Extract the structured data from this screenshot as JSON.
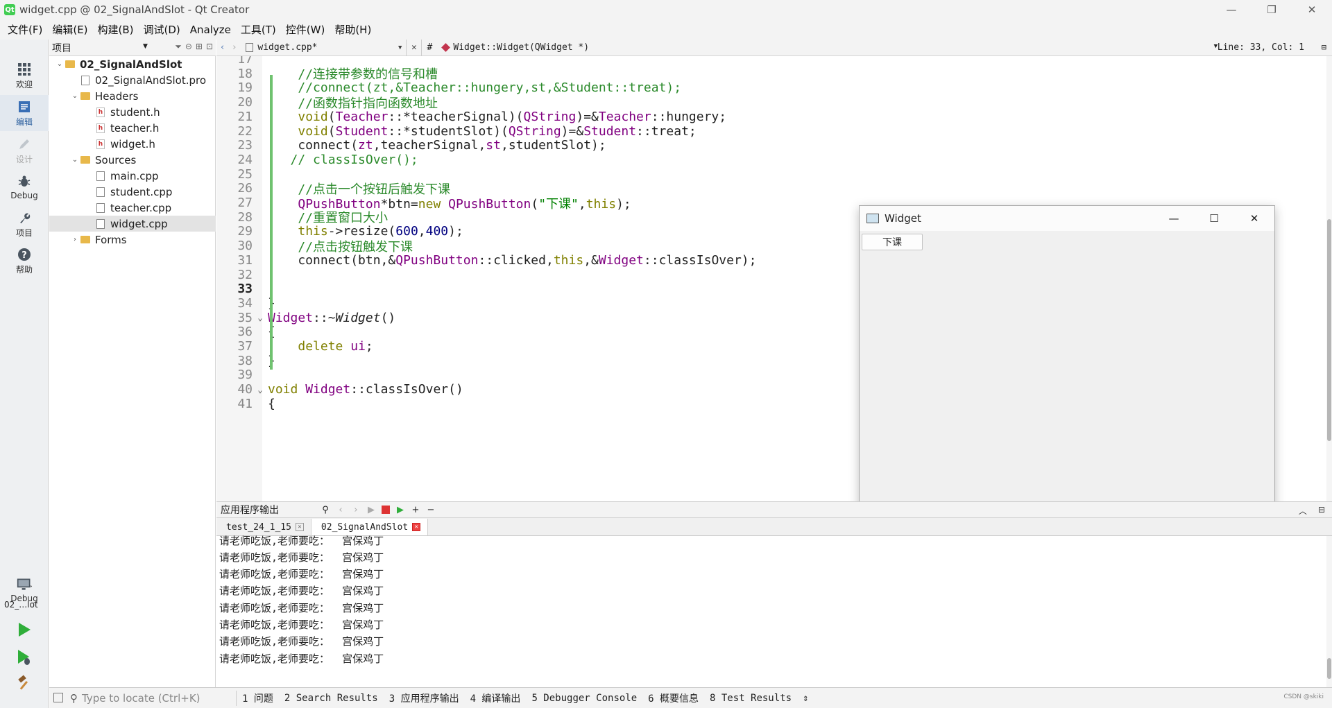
{
  "window": {
    "title": "widget.cpp @ 02_SignalAndSlot - Qt Creator",
    "app_icon": "Qt",
    "controls": [
      "—",
      "❐",
      "✕"
    ]
  },
  "menu": [
    "文件(F)",
    "编辑(E)",
    "构建(B)",
    "调试(D)",
    "Analyze",
    "工具(T)",
    "控件(W)",
    "帮助(H)"
  ],
  "modes": [
    {
      "label": "欢迎",
      "icon": "grid-icon"
    },
    {
      "label": "编辑",
      "icon": "edit-icon"
    },
    {
      "label": "设计",
      "icon": "pencil-icon"
    },
    {
      "label": "Debug",
      "icon": "bug-icon"
    },
    {
      "label": "项目",
      "icon": "wrench-icon"
    },
    {
      "label": "帮助",
      "icon": "help-icon"
    }
  ],
  "kit": {
    "name": "02_…lot",
    "config": "Debug"
  },
  "project_pane": {
    "title": "项目",
    "tree": [
      {
        "label": "02_SignalAndSlot",
        "arrow": "⌄",
        "type": "project"
      },
      {
        "label": "02_SignalAndSlot.pro",
        "arrow": "",
        "type": "pro"
      },
      {
        "label": "Headers",
        "arrow": "⌄",
        "type": "folder"
      },
      {
        "label": "student.h",
        "arrow": "",
        "type": "h"
      },
      {
        "label": "teacher.h",
        "arrow": "",
        "type": "h"
      },
      {
        "label": "widget.h",
        "arrow": "",
        "type": "h"
      },
      {
        "label": "Sources",
        "arrow": "⌄",
        "type": "folder"
      },
      {
        "label": "main.cpp",
        "arrow": "",
        "type": "cpp"
      },
      {
        "label": "student.cpp",
        "arrow": "",
        "type": "cpp"
      },
      {
        "label": "teacher.cpp",
        "arrow": "",
        "type": "cpp"
      },
      {
        "label": "widget.cpp",
        "arrow": "",
        "type": "cpp",
        "selected": true
      },
      {
        "label": "Forms",
        "arrow": "›",
        "type": "folder"
      }
    ]
  },
  "editor_toolbar": {
    "file": "widget.cpp*",
    "hash": "#",
    "symbol": "Widget::Widget(QWidget *)",
    "position": "Line: 33, Col: 1"
  },
  "code": [
    {
      "n": "17",
      "fold": "",
      "parts": [
        {
          "t": "",
          "c": ""
        }
      ]
    },
    {
      "n": "18",
      "fold": "",
      "parts": [
        {
          "t": "    ",
          "c": ""
        },
        {
          "t": "//连接带参数的信号和槽",
          "c": "c-com"
        }
      ]
    },
    {
      "n": "19",
      "fold": "",
      "parts": [
        {
          "t": "    ",
          "c": ""
        },
        {
          "t": "//connect(zt,&Teacher::hungery,st,&Student::treat);",
          "c": "c-com"
        }
      ]
    },
    {
      "n": "20",
      "fold": "",
      "parts": [
        {
          "t": "    ",
          "c": ""
        },
        {
          "t": "//函数指针指向函数地址",
          "c": "c-com"
        }
      ]
    },
    {
      "n": "21",
      "fold": "",
      "parts": [
        {
          "t": "    ",
          "c": ""
        },
        {
          "t": "void",
          "c": "c-kw"
        },
        {
          "t": "(",
          "c": ""
        },
        {
          "t": "Teacher",
          "c": "c-type"
        },
        {
          "t": "::*teacherSignal)(",
          "c": ""
        },
        {
          "t": "QString",
          "c": "c-type"
        },
        {
          "t": ")=&",
          "c": ""
        },
        {
          "t": "Teacher",
          "c": "c-type"
        },
        {
          "t": "::hungery;",
          "c": ""
        }
      ]
    },
    {
      "n": "22",
      "fold": "",
      "parts": [
        {
          "t": "    ",
          "c": ""
        },
        {
          "t": "void",
          "c": "c-kw"
        },
        {
          "t": "(",
          "c": ""
        },
        {
          "t": "Student",
          "c": "c-type"
        },
        {
          "t": "::*studentSlot)(",
          "c": ""
        },
        {
          "t": "QString",
          "c": "c-type"
        },
        {
          "t": ")=&",
          "c": ""
        },
        {
          "t": "Student",
          "c": "c-type"
        },
        {
          "t": "::treat;",
          "c": ""
        }
      ]
    },
    {
      "n": "23",
      "fold": "",
      "parts": [
        {
          "t": "    connect(",
          "c": ""
        },
        {
          "t": "zt",
          "c": "c-type"
        },
        {
          "t": ",teacherSignal,",
          "c": ""
        },
        {
          "t": "st",
          "c": "c-type"
        },
        {
          "t": ",studentSlot);",
          "c": ""
        }
      ]
    },
    {
      "n": "24",
      "fold": "",
      "parts": [
        {
          "t": "   ",
          "c": ""
        },
        {
          "t": "// classIsOver();",
          "c": "c-com"
        }
      ]
    },
    {
      "n": "25",
      "fold": "",
      "parts": [
        {
          "t": "",
          "c": ""
        }
      ]
    },
    {
      "n": "26",
      "fold": "",
      "parts": [
        {
          "t": "    ",
          "c": ""
        },
        {
          "t": "//点击一个按钮后触发下课",
          "c": "c-com"
        }
      ]
    },
    {
      "n": "27",
      "fold": "",
      "parts": [
        {
          "t": "    ",
          "c": ""
        },
        {
          "t": "QPushButton",
          "c": "c-type"
        },
        {
          "t": "*btn=",
          "c": ""
        },
        {
          "t": "new",
          "c": "c-kw"
        },
        {
          "t": " ",
          "c": ""
        },
        {
          "t": "QPushButton",
          "c": "c-type"
        },
        {
          "t": "(",
          "c": ""
        },
        {
          "t": "\"下课\"",
          "c": "c-str"
        },
        {
          "t": ",",
          "c": ""
        },
        {
          "t": "this",
          "c": "c-kw"
        },
        {
          "t": ");",
          "c": ""
        }
      ]
    },
    {
      "n": "28",
      "fold": "",
      "parts": [
        {
          "t": "    ",
          "c": ""
        },
        {
          "t": "//重置窗口大小",
          "c": "c-com"
        }
      ]
    },
    {
      "n": "29",
      "fold": "",
      "parts": [
        {
          "t": "    ",
          "c": ""
        },
        {
          "t": "this",
          "c": "c-kw"
        },
        {
          "t": "->resize(",
          "c": ""
        },
        {
          "t": "600",
          "c": "c-num"
        },
        {
          "t": ",",
          "c": ""
        },
        {
          "t": "400",
          "c": "c-num"
        },
        {
          "t": ");",
          "c": ""
        }
      ]
    },
    {
      "n": "30",
      "fold": "",
      "parts": [
        {
          "t": "    ",
          "c": ""
        },
        {
          "t": "//点击按钮触发下课",
          "c": "c-com"
        }
      ]
    },
    {
      "n": "31",
      "fold": "",
      "parts": [
        {
          "t": "    connect(btn,&",
          "c": ""
        },
        {
          "t": "QPushButton",
          "c": "c-type"
        },
        {
          "t": "::clicked,",
          "c": ""
        },
        {
          "t": "this",
          "c": "c-kw"
        },
        {
          "t": ",&",
          "c": ""
        },
        {
          "t": "Widget",
          "c": "c-type"
        },
        {
          "t": "::classIsOver);",
          "c": ""
        }
      ]
    },
    {
      "n": "32",
      "fold": "",
      "parts": [
        {
          "t": "",
          "c": ""
        }
      ]
    },
    {
      "n": "33",
      "fold": "",
      "current": true,
      "parts": [
        {
          "t": "",
          "c": ""
        }
      ]
    },
    {
      "n": "34",
      "fold": "",
      "parts": [
        {
          "t": "}",
          "c": ""
        }
      ]
    },
    {
      "n": "35",
      "fold": "⌄",
      "parts": [
        {
          "t": "Widget",
          "c": "c-type"
        },
        {
          "t": "::~",
          "c": ""
        },
        {
          "t": "Widget",
          "c": "c-it"
        },
        {
          "t": "()",
          "c": ""
        }
      ]
    },
    {
      "n": "36",
      "fold": "",
      "parts": [
        {
          "t": "{",
          "c": ""
        }
      ]
    },
    {
      "n": "37",
      "fold": "",
      "parts": [
        {
          "t": "    ",
          "c": ""
        },
        {
          "t": "delete",
          "c": "c-kw"
        },
        {
          "t": " ",
          "c": ""
        },
        {
          "t": "ui",
          "c": "c-type"
        },
        {
          "t": ";",
          "c": ""
        }
      ]
    },
    {
      "n": "38",
      "fold": "",
      "parts": [
        {
          "t": "}",
          "c": ""
        }
      ]
    },
    {
      "n": "39",
      "fold": "",
      "parts": [
        {
          "t": "",
          "c": ""
        }
      ]
    },
    {
      "n": "40",
      "fold": "⌄",
      "parts": [
        {
          "t": "void",
          "c": "c-kw"
        },
        {
          "t": " ",
          "c": ""
        },
        {
          "t": "Widget",
          "c": "c-type"
        },
        {
          "t": "::classIsOver()",
          "c": ""
        }
      ]
    },
    {
      "n": "41",
      "fold": "",
      "parts": [
        {
          "t": "{",
          "c": ""
        }
      ]
    }
  ],
  "widget_window": {
    "title": "Widget",
    "button_label": "下课",
    "controls": [
      "—",
      "☐",
      "✕"
    ]
  },
  "output": {
    "title": "应用程序输出",
    "tabs": [
      {
        "label": "test_24_1_15",
        "active": false
      },
      {
        "label": "02_SignalAndSlot",
        "active": true
      }
    ],
    "lines": [
      "请老师吃饭,老师要吃：  宫保鸡丁",
      "请老师吃饭,老师要吃：  宫保鸡丁",
      "请老师吃饭,老师要吃：  宫保鸡丁",
      "请老师吃饭,老师要吃：  宫保鸡丁",
      "请老师吃饭,老师要吃：  宫保鸡丁",
      "请老师吃饭,老师要吃：  宫保鸡丁",
      "请老师吃饭,老师要吃：  宫保鸡丁",
      "请老师吃饭,老师要吃：  宫保鸡丁"
    ]
  },
  "statusbar": {
    "locator_placeholder": "Type to locate (Ctrl+K)",
    "panes": [
      "1 问题",
      "2 Search Results",
      "3 应用程序输出",
      "4 编译输出",
      "5 Debugger Console",
      "6 概要信息",
      "8 Test Results"
    ],
    "watermark": "CSDN @skiki"
  },
  "colors": {
    "comment": "#2b8a2b",
    "keyword": "#808000",
    "type": "#800080",
    "string": "#008000",
    "number": "#000080",
    "accent": "#41cd52"
  }
}
